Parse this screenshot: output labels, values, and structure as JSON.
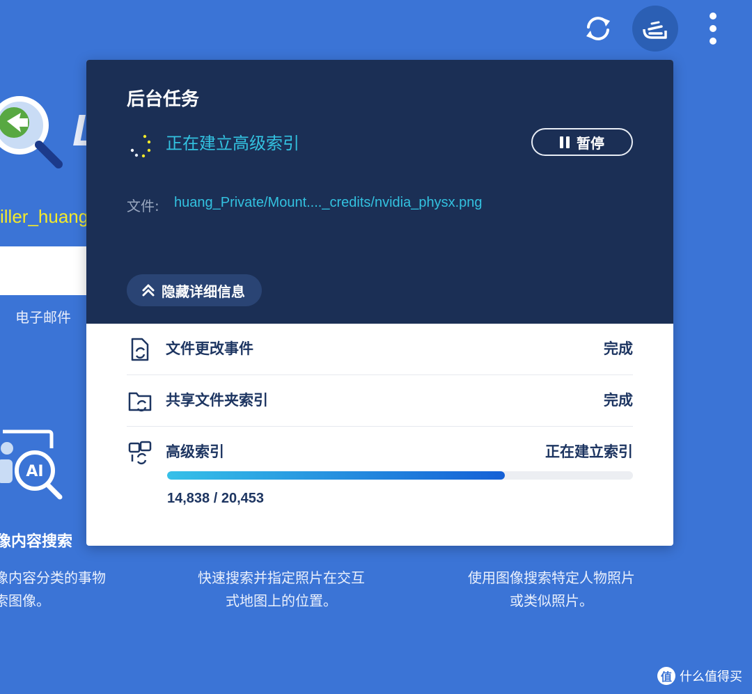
{
  "topbar": {
    "sync_icon": "refresh-icon",
    "tasks_icon": "background-tasks-icon",
    "more_icon": "more-vertical-icon"
  },
  "background": {
    "brand_partial": "L",
    "username_partial": "iller_huang",
    "email_label": "电子邮件",
    "features": [
      {
        "title": "像内容搜索",
        "desc": [
          "像内容分类的事物",
          "索图像。"
        ]
      },
      {
        "title": "",
        "desc": [
          "快速搜索并指定照片在交互",
          "式地图上的位置。"
        ]
      },
      {
        "title": "",
        "desc": [
          "使用图像搜索特定人物照片",
          "或类似照片。"
        ]
      }
    ],
    "watermark": "什么值得买",
    "watermark_glyph": "值"
  },
  "popup": {
    "title": "后台任务",
    "current_task": "正在建立高级索引",
    "pause_label": "暂停",
    "file_label": "文件:",
    "file_path": "huang_Private/Mount...._credits/nvidia_physx.png",
    "hide_details_label": "隐藏详细信息",
    "tasks": [
      {
        "name": "文件更改事件",
        "status": "完成",
        "icon": "file-sync-icon"
      },
      {
        "name": "共享文件夹索引",
        "status": "完成",
        "icon": "folder-sync-icon"
      },
      {
        "name": "高级索引",
        "status": "正在建立索引",
        "icon": "advanced-index-icon"
      }
    ],
    "progress": {
      "current": 14838,
      "total": 20453,
      "label": "14,838 / 20,453"
    }
  },
  "colors": {
    "background": "#3b74d6",
    "panel_dark": "#1b2f55",
    "accent_cyan": "#33c2e0",
    "text_dark": "#1d3561",
    "username_yellow": "#f4ea2a"
  }
}
